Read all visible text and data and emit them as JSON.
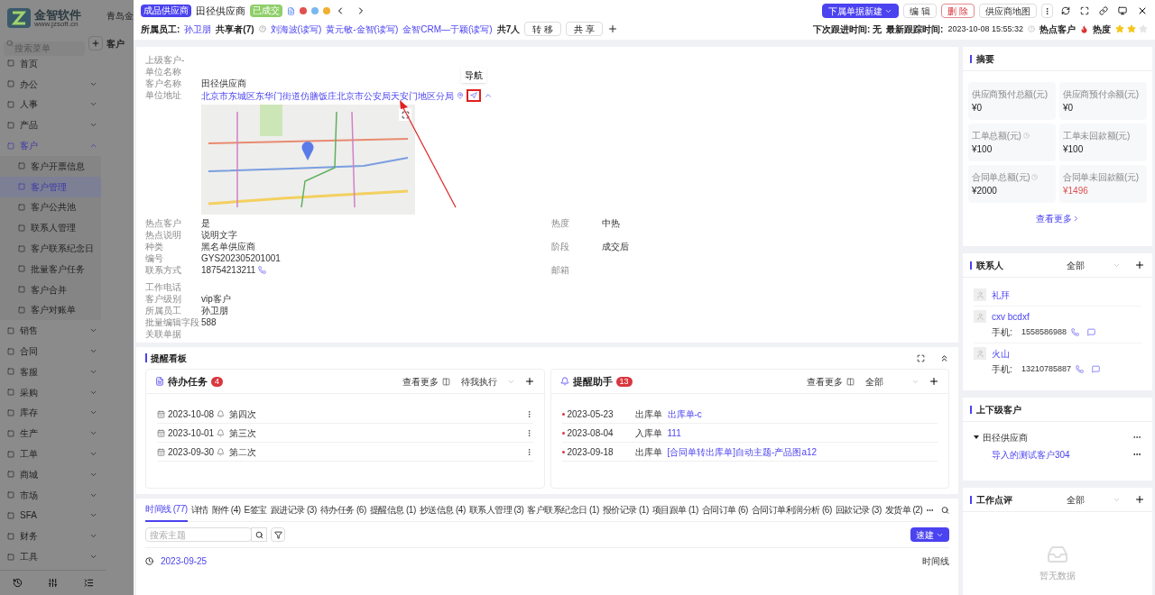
{
  "app": {
    "logo_name": "金智软件",
    "logo_url": "www.jzsoft.cn",
    "search_placeholder": "搜索菜单",
    "background_title": "青岛金",
    "background_heading": "客户",
    "menu": [
      {
        "label": "首页",
        "kind": "link"
      },
      {
        "label": "办公",
        "kind": "group",
        "expanded": false
      },
      {
        "label": "人事",
        "kind": "group",
        "expanded": false
      },
      {
        "label": "产品",
        "kind": "group",
        "expanded": false
      },
      {
        "label": "客户",
        "kind": "group",
        "expanded": true,
        "children": [
          {
            "label": "客户开票信息",
            "selected": false
          },
          {
            "label": "客户管理",
            "selected": true
          },
          {
            "label": "客户公共池",
            "selected": false
          },
          {
            "label": "联系人管理",
            "selected": false
          },
          {
            "label": "客户联系纪念日",
            "selected": false
          },
          {
            "label": "批量客户任务",
            "selected": false
          },
          {
            "label": "客户合并",
            "selected": false
          },
          {
            "label": "客户对账单",
            "selected": false
          }
        ]
      },
      {
        "label": "销售",
        "kind": "group",
        "expanded": false
      },
      {
        "label": "合同",
        "kind": "group",
        "expanded": false
      },
      {
        "label": "客服",
        "kind": "group",
        "expanded": false
      },
      {
        "label": "采购",
        "kind": "group",
        "expanded": false
      },
      {
        "label": "库存",
        "kind": "group",
        "expanded": false
      },
      {
        "label": "生产",
        "kind": "group",
        "expanded": false
      },
      {
        "label": "工单",
        "kind": "group",
        "expanded": false
      },
      {
        "label": "商城",
        "kind": "group",
        "expanded": false
      },
      {
        "label": "市场",
        "kind": "group",
        "expanded": false
      },
      {
        "label": "SFA",
        "kind": "group",
        "expanded": false
      },
      {
        "label": "财务",
        "kind": "group",
        "expanded": false
      },
      {
        "label": "工具",
        "kind": "group",
        "expanded": false
      }
    ]
  },
  "header": {
    "tag": "成品供应商",
    "title": "田径供应商",
    "status": "已成交",
    "owner_label": "所属员工:",
    "owner": "孙卫朋",
    "sharers_label": "共享者(7)",
    "sharers": [
      "刘海波(读写)",
      "黄元敏-金智(读写)",
      "金智CRM—于颖(读写)"
    ],
    "share_count": "共7人",
    "transfer": "转 移",
    "share": "共 享",
    "buttons": [
      {
        "label": "下属单据新建",
        "kind": "primary"
      },
      {
        "label": "编 辑",
        "kind": "default"
      },
      {
        "label": "删 除",
        "kind": "danger"
      },
      {
        "label": "供应商地图",
        "kind": "default"
      }
    ],
    "next_follow": "下次跟进时间: 无",
    "latest_follow_label": "最新跟踪时间:",
    "latest_follow": "2023-10-08 15:55:32",
    "hot_label": "热点客户",
    "heat_label": "热度",
    "stars": 2
  },
  "details": {
    "tooltip": "导航",
    "rows": [
      {
        "label": "上级客户-单位名称",
        "value": "",
        "kind": "text"
      },
      {
        "label": "客户名称",
        "value": "田径供应商",
        "kind": "text"
      },
      {
        "label": "单位地址",
        "value": "北京市东城区东华门街道仿膳饭庄北京市公安局天安门地区分局",
        "kind": "address"
      },
      {
        "label": "热点客户",
        "value": "是",
        "kind": "text",
        "side_label": "热度",
        "side_value": "中热"
      },
      {
        "label": "热点说明",
        "value": "说明文字",
        "kind": "text"
      },
      {
        "label": "种类",
        "value": "黑名单供应商",
        "kind": "text",
        "side_label": "阶段",
        "side_value": "成交后"
      },
      {
        "label": "编号",
        "value": "GYS202305201001",
        "kind": "text"
      },
      {
        "label": "联系方式",
        "value": "18754213211",
        "kind": "phone",
        "side_label": "邮箱",
        "side_value": ""
      },
      {
        "label": "工作电话",
        "value": "",
        "kind": "text"
      },
      {
        "label": "客户级别",
        "value": "vip客户",
        "kind": "text"
      },
      {
        "label": "所属员工",
        "value": "孙卫朋",
        "kind": "text"
      },
      {
        "label": "批量编辑字段",
        "value": "588",
        "kind": "text"
      },
      {
        "label": "关联单据",
        "value": "",
        "kind": "text"
      }
    ]
  },
  "board": {
    "title": "提醒看板",
    "tasks": {
      "title": "待办任务",
      "count": "4",
      "more": "查看更多",
      "filter": "待我执行",
      "rows": [
        {
          "date": "2023-10-08",
          "text": "第四次"
        },
        {
          "date": "2023-10-01",
          "text": "第三次"
        },
        {
          "date": "2023-09-30",
          "text": "第二次"
        }
      ]
    },
    "reminders": {
      "title": "提醒助手",
      "count": "13",
      "more": "查看更多",
      "filter": "全部",
      "rows": [
        {
          "date": "2023-05-23",
          "type": "出库单",
          "link": "出库单-c"
        },
        {
          "date": "2023-08-04",
          "type": "入库单",
          "link": "111"
        },
        {
          "date": "2023-09-18",
          "type": "出库单",
          "link": "[合同单转出库单]自动主题-产品图a12"
        }
      ]
    }
  },
  "tabs": [
    {
      "label": "时间线 (77)",
      "selected": true
    },
    {
      "label": "详情",
      "selected": false
    },
    {
      "label": "附件 (4)",
      "selected": false
    },
    {
      "label": "E签宝",
      "selected": false
    },
    {
      "label": "跟进记录 (3)",
      "selected": false
    },
    {
      "label": "待办任务 (6)",
      "selected": false
    },
    {
      "label": "提醒信息 (1)",
      "selected": false
    },
    {
      "label": "抄送信息 (4)",
      "selected": false
    },
    {
      "label": "联系人管理 (3)",
      "selected": false
    },
    {
      "label": "客户联系纪念日 (1)",
      "selected": false
    },
    {
      "label": "报价记录 (1)",
      "selected": false
    },
    {
      "label": "项目跟单 (1)",
      "selected": false
    },
    {
      "label": "合同订单 (6)",
      "selected": false
    },
    {
      "label": "合同订单利润分析 (6)",
      "selected": false
    },
    {
      "label": "回款记录 (3)",
      "selected": false
    },
    {
      "label": "发货单 (2)",
      "selected": false
    }
  ],
  "timeline": {
    "search_placeholder": "搜索主题",
    "quick_create": "速建",
    "date": "2023-09-25",
    "view": "时间线"
  },
  "summary": {
    "title": "摘要",
    "more": "查看更多",
    "stats": [
      {
        "label": "供应商预付总额(元)",
        "value": "¥0",
        "help": false,
        "alert": false
      },
      {
        "label": "供应商预付余额(元)",
        "value": "¥0",
        "help": false,
        "alert": false
      },
      {
        "label": "工单总额(元)",
        "value": "¥100",
        "help": true,
        "alert": false
      },
      {
        "label": "工单未回款额(元)",
        "value": "¥100",
        "help": false,
        "alert": false
      },
      {
        "label": "合同单总额(元)",
        "value": "¥2000",
        "help": true,
        "alert": false
      },
      {
        "label": "合同单未回款额(元)",
        "value": "¥1496",
        "help": false,
        "alert": true
      }
    ]
  },
  "contacts": {
    "title": "联系人",
    "filter": "全部",
    "items": [
      {
        "name": "礼拜"
      },
      {
        "name": "cxv bcdxf",
        "phone_label": "手机:",
        "phone": "1558586988"
      },
      {
        "name": "火山",
        "phone_label": "手机:",
        "phone": "13210785887"
      }
    ]
  },
  "hierarchy": {
    "title": "上下级客户",
    "tree": [
      {
        "label": "田径供应商",
        "expanded": true,
        "children": [
          {
            "label": "导入的测试客户304"
          }
        ]
      }
    ]
  },
  "reviews": {
    "title": "工作点评",
    "filter": "全部",
    "empty": "暂无数据"
  }
}
